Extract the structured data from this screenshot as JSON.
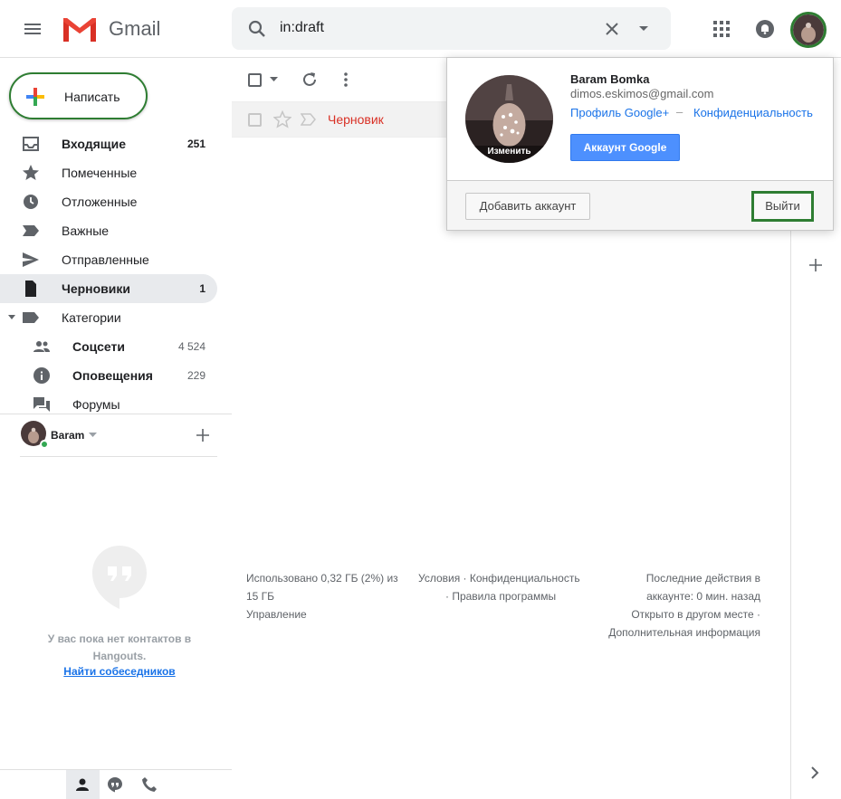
{
  "header": {
    "app_name": "Gmail",
    "search_value": "in:draft"
  },
  "compose": {
    "label": "Написать"
  },
  "nav": [
    {
      "label": "Входящие",
      "count": "251"
    },
    {
      "label": "Помеченные",
      "count": ""
    },
    {
      "label": "Отложенные",
      "count": ""
    },
    {
      "label": "Важные",
      "count": ""
    },
    {
      "label": "Отправленные",
      "count": ""
    },
    {
      "label": "Черновики",
      "count": "1"
    },
    {
      "label": "Категории",
      "count": ""
    },
    {
      "label": "Соцсети",
      "count": "4 524"
    },
    {
      "label": "Оповещения",
      "count": "229"
    },
    {
      "label": "Форумы",
      "count": ""
    }
  ],
  "hangouts": {
    "user_name": "Baram",
    "empty_text": "У вас пока нет контактов в Hangouts.",
    "find_link": "Найти собеседников"
  },
  "main": {
    "draft_row_label": "Черновик",
    "footer": {
      "storage": "Использовано 0,32 ГБ (2%) из 15 ГБ",
      "manage": "Управление",
      "terms_line1": "Условия · Конфиденциальность",
      "terms_line2": "· Правила программы",
      "activity_line1": "Последние действия в",
      "activity_line2": "аккаунте: 0 мин. назад",
      "activity_line3": "Открыто в другом месте ·",
      "activity_line4": "Дополнительная информация"
    }
  },
  "account_popup": {
    "name": "Baram Bomka",
    "email": "dimos.eskimos@gmail.com",
    "change_label": "Изменить",
    "profile_link": "Профиль Google+",
    "separator": "–",
    "privacy_link": "Конфиденциальность",
    "google_account_button": "Аккаунт Google",
    "add_account_button": "Добавить аккаунт",
    "logout_button": "Выйти"
  },
  "colors": {
    "highlight_green": "#2e7d32",
    "draft_red": "#d93025",
    "link_blue": "#1a73e8",
    "google_button_blue": "#4d90fe"
  }
}
